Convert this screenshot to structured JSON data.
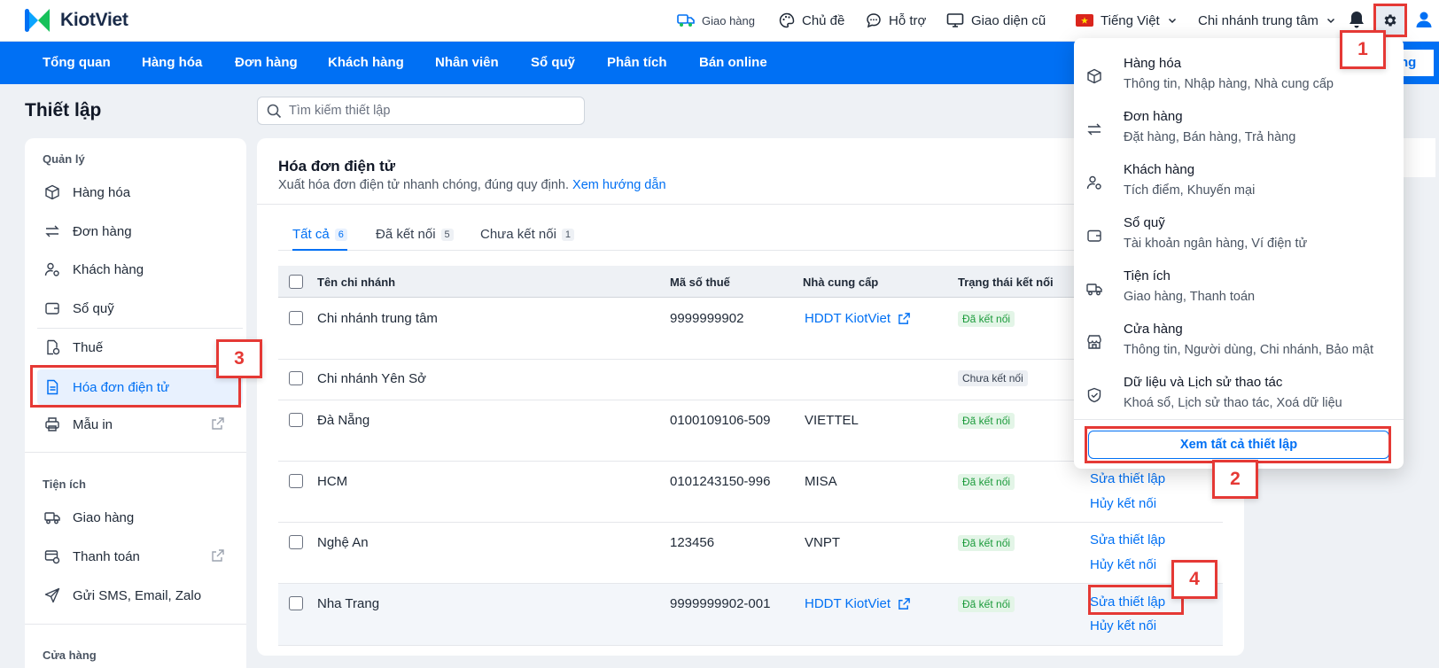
{
  "brand": {
    "name": "KiotViet"
  },
  "topbar": {
    "delivery": "Giao hàng",
    "theme": "Chủ đề",
    "support": "Hỗ trợ",
    "old_ui": "Giao diện cũ",
    "language": "Tiếng Việt",
    "branch": "Chi nhánh trung tâm"
  },
  "nav": {
    "items": [
      "Tổng quan",
      "Hàng hóa",
      "Đơn hàng",
      "Khách hàng",
      "Nhân viên",
      "Sổ quỹ",
      "Phân tích",
      "Bán online"
    ],
    "right_button": "ng"
  },
  "page": {
    "title": "Thiết lập",
    "search_placeholder": "Tìm kiếm thiết lập"
  },
  "sidebar": {
    "group_manage": "Quản lý",
    "items_manage": [
      "Hàng hóa",
      "Đơn hàng",
      "Khách hàng",
      "Sổ quỹ",
      "Thuế",
      "Hóa đơn điện tử",
      "Mẫu in"
    ],
    "group_utility": "Tiện ích",
    "items_utility": [
      "Giao hàng",
      "Thanh toán",
      "Gửi SMS, Email, Zalo"
    ],
    "group_store": "Cửa hàng"
  },
  "card": {
    "title": "Hóa đơn điện tử",
    "description": "Xuất hóa đơn điện tử nhanh chóng, đúng quy định.",
    "guide_link": "Xem hướng dẫn",
    "tabs": [
      {
        "label": "Tất cả",
        "count": "6"
      },
      {
        "label": "Đã kết nối",
        "count": "5"
      },
      {
        "label": "Chưa kết nối",
        "count": "1"
      }
    ],
    "columns": [
      "Tên chi nhánh",
      "Mã số thuế",
      "Nhà cung cấp",
      "Trạng thái kết nối"
    ],
    "rows": [
      {
        "branch": "Chi nhánh trung tâm",
        "tax": "9999999902",
        "provider": "HDDT KiotViet",
        "status": "Đã kết nối"
      },
      {
        "branch": "Chi nhánh Yên Sở",
        "tax": "",
        "provider": "",
        "status": "Chưa kết nối"
      },
      {
        "branch": "Đà Nẵng",
        "tax": "0100109106-509",
        "provider": "VIETTEL",
        "status": "Đã kết nối"
      },
      {
        "branch": "HCM",
        "tax": "0101243150-996",
        "provider": "MISA",
        "status": "Đã kết nối"
      },
      {
        "branch": "Nghệ An",
        "tax": "123456",
        "provider": "VNPT",
        "status": "Đã kết nối"
      },
      {
        "branch": "Nha Trang",
        "tax": "9999999902-001",
        "provider": "HDDT KiotViet",
        "status": "Đã kết nối"
      }
    ],
    "action_edit": "Sửa thiết lập",
    "action_disconnect": "Hủy kết nối"
  },
  "dropdown": {
    "items": [
      {
        "title": "Hàng hóa",
        "sub": "Thông tin, Nhập hàng, Nhà cung cấp"
      },
      {
        "title": "Đơn hàng",
        "sub": "Đặt hàng, Bán hàng, Trả hàng"
      },
      {
        "title": "Khách hàng",
        "sub": "Tích điểm, Khuyến mại"
      },
      {
        "title": "Sổ quỹ",
        "sub": "Tài khoản ngân hàng, Ví điện tử"
      },
      {
        "title": "Tiện ích",
        "sub": "Giao hàng, Thanh toán"
      },
      {
        "title": "Cửa hàng",
        "sub": "Thông tin, Người dùng, Chi nhánh, Bảo mật"
      },
      {
        "title": "Dữ liệu và Lịch sử thao tác",
        "sub": "Khoá sổ, Lịch sử thao tác, Xoá dữ liệu"
      }
    ],
    "view_all": "Xem tất cả thiết lập"
  },
  "annotations": [
    "1",
    "2",
    "3",
    "4"
  ],
  "colors": {
    "brand_blue": "#0070f4",
    "annotation_red": "#e53935",
    "success_green": "#1a9a3a"
  }
}
